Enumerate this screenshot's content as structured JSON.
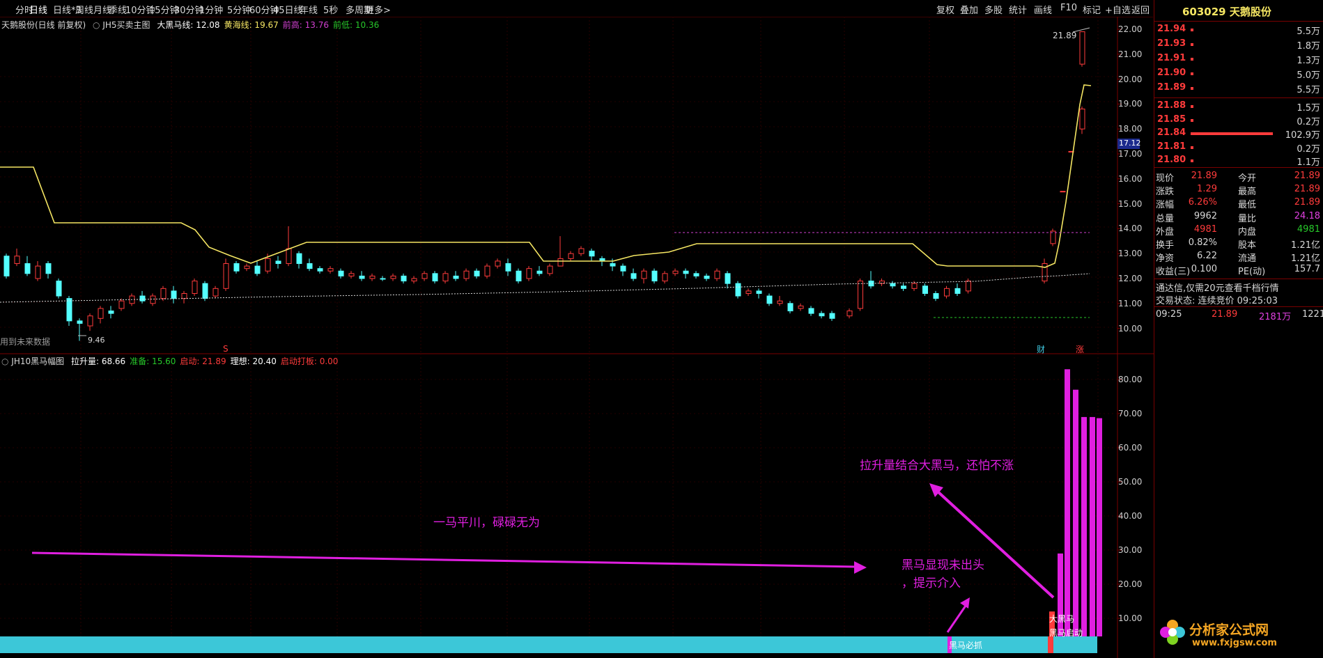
{
  "toolbar": {
    "tabs": [
      "分时",
      "日线",
      "日线*3",
      "周线",
      "月线",
      "季线",
      "10分钟",
      "15分钟",
      "30分钟",
      "1分钟",
      "5分钟",
      "60分钟",
      "45日线",
      "年线",
      "5秒",
      "多周期",
      "更多>"
    ],
    "right_buttons": [
      "复权",
      "叠加",
      "多股",
      "统计",
      "画线",
      "F10",
      "标记",
      "+自选",
      "返回"
    ]
  },
  "main_chart": {
    "stock_title": "天鹅股份(日线 前复权)",
    "indicator_name": "JH5买卖主图",
    "lines": [
      {
        "label": "大黑马线: 12.08",
        "color": "#ffffff"
      },
      {
        "label": "黄海线: 19.67",
        "color": "#f5e663"
      },
      {
        "label": "前高: 13.76",
        "color": "#d040d0"
      },
      {
        "label": "前低: 10.36",
        "color": "#27c82a"
      }
    ],
    "price_axis": [
      "22.00",
      "21.00",
      "20.00",
      "19.00",
      "18.00",
      "17.00",
      "16.00",
      "15.00",
      "14.00",
      "13.00",
      "12.00",
      "11.00",
      "10.00"
    ],
    "current_tag": "17.12",
    "high_label": "21.89",
    "low_label": "9.46",
    "future_note": "用到未来数据",
    "markers": {
      "left": "S",
      "cai": "财",
      "zhang": "涨"
    }
  },
  "sub_chart": {
    "indicator_name": "JH10黑马幅图",
    "labels": [
      {
        "label": "拉升量: 68.66",
        "color": "#ffffff"
      },
      {
        "label": "准备: 15.60",
        "color": "#27c82a"
      },
      {
        "label": "启动: 21.89",
        "color": "#ff3b3b"
      },
      {
        "label": "理想: 20.40",
        "color": "#ffffff"
      },
      {
        "label": "启动打板: 0.00",
        "color": "#ff3b3b"
      }
    ],
    "axis": [
      "80.00",
      "70.00",
      "60.00",
      "50.00",
      "40.00",
      "30.00",
      "20.00",
      "10.00"
    ],
    "bar_values": [
      12,
      29,
      83,
      77,
      69,
      69,
      68.66
    ],
    "bottom_labels": {
      "black_horse": "黑马必抓",
      "big_horse": "大黑马",
      "horse_start": "黑马启动"
    }
  },
  "annotations": {
    "flat": "一马平川，碌碌无为",
    "appear_line1": "黑马显现未出头",
    "appear_line2": "，提示介入",
    "combine": "拉升量结合大黑马，还怕不涨"
  },
  "quote": {
    "code_name": "603029 天鹅股份",
    "asks": [
      {
        "price": "21.94",
        "vol": "5.5万"
      },
      {
        "price": "21.93",
        "vol": "1.8万"
      },
      {
        "price": "21.91",
        "vol": "1.3万"
      },
      {
        "price": "21.90",
        "vol": "5.0万"
      },
      {
        "price": "21.89",
        "vol": "5.5万"
      }
    ],
    "bids": [
      {
        "price": "21.88",
        "vol": "1.5万"
      },
      {
        "price": "21.85",
        "vol": "0.2万"
      },
      {
        "price": "21.84",
        "vol": "102.9万"
      },
      {
        "price": "21.81",
        "vol": "0.2万"
      },
      {
        "price": "21.80",
        "vol": "1.1万"
      }
    ],
    "stats": [
      {
        "l1": "现价",
        "v1": "21.89",
        "c1": "#ff3b3b",
        "l2": "今开",
        "v2": "21.89",
        "c2": "#ff3b3b"
      },
      {
        "l1": "涨跌",
        "v1": "1.29",
        "c1": "#ff3b3b",
        "l2": "最高",
        "v2": "21.89",
        "c2": "#ff3b3b"
      },
      {
        "l1": "涨幅",
        "v1": "6.26%",
        "c1": "#ff3b3b",
        "l2": "最低",
        "v2": "21.89",
        "c2": "#ff3b3b"
      },
      {
        "l1": "总量",
        "v1": "9962",
        "c1": "#d8d8d8",
        "l2": "量比",
        "v2": "24.18",
        "c2": "#e040e0"
      },
      {
        "l1": "外盘",
        "v1": "4981",
        "c1": "#ff3b3b",
        "l2": "内盘",
        "v2": "4981",
        "c2": "#27c82a"
      },
      {
        "l1": "换手",
        "v1": "0.82%",
        "c1": "#d8d8d8",
        "l2": "股本",
        "v2": "1.21亿",
        "c2": "#d8d8d8"
      },
      {
        "l1": "净资",
        "v1": "6.22",
        "c1": "#d8d8d8",
        "l2": "流通",
        "v2": "1.21亿",
        "c2": "#d8d8d8"
      },
      {
        "l1": "收益(三)",
        "v1": "0.100",
        "c1": "#d8d8d8",
        "l2": "PE(动)",
        "v2": "157.7",
        "c2": "#d8d8d8"
      }
    ],
    "promo": "通达信,仅需20元查看千档行情",
    "trade_status": "交易状态: 连续竞价 09:25:03",
    "tick": {
      "time": "09:25",
      "price": "21.89",
      "vol": "2181万",
      "count": "1221"
    },
    "brand": "分析家公式网",
    "brand_url": "www.fxjgsw.com"
  }
}
